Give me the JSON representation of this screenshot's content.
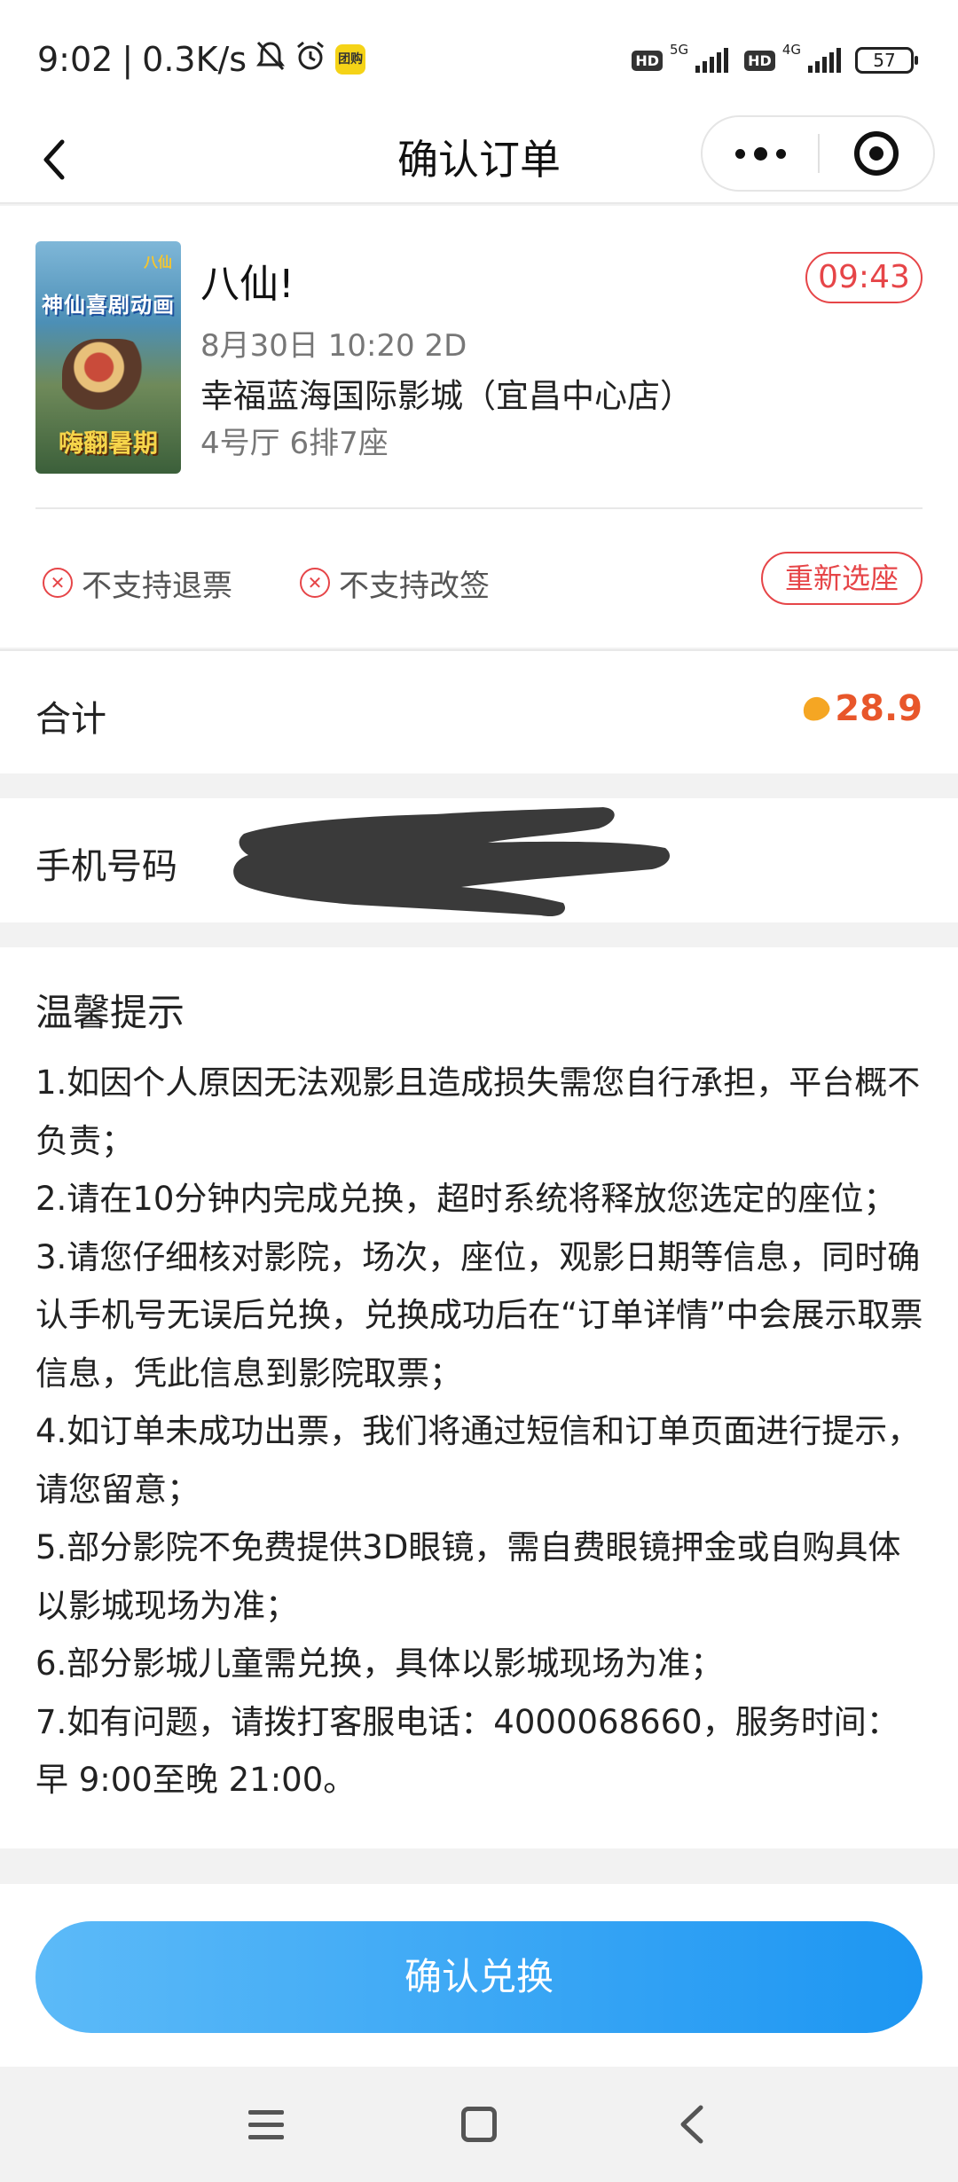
{
  "status_bar": {
    "time": "9:02",
    "speed": "0.3K/s",
    "hd1": "HD",
    "net1": "5G",
    "hd2": "HD",
    "net2": "4G",
    "battery": "57",
    "app_badge": "团购"
  },
  "nav": {
    "title": "确认订单",
    "back_icon": "chevron-left-icon",
    "more_icon": "more-dots-icon",
    "close_icon": "target-close-icon"
  },
  "order": {
    "poster_top_text": "神仙喜剧动画",
    "poster_logo_text": "八仙",
    "poster_bottom_text": "嗨翻暑期",
    "movie_title": "八仙!",
    "countdown": "09:43",
    "show_info": "8月30日  10:20  2D",
    "cinema": "幸福蓝海国际影城（宜昌中心店）",
    "seat_info": "4号厅  6排7座",
    "policies": [
      "不支持退票",
      "不支持改签"
    ],
    "reselect_label": "重新选座"
  },
  "total": {
    "label": "合计",
    "value": "28.9",
    "currency_icon": "coin-icon"
  },
  "phone": {
    "label": "手机号码"
  },
  "tips": {
    "title": "温馨提示",
    "items": [
      "1.如因个人原因无法观影且造成损失需您自行承担，平台概不负责；",
      "2.请在10分钟内完成兑换，超时系统将释放您选定的座位；",
      "3.请您仔细核对影院，场次，座位，观影日期等信息，同时确认手机号无误后兑换，兑换成功后在“订单详情”中会展示取票信息，凭此信息到影院取票；",
      "4.如订单未成功出票，我们将通过短信和订单页面进行提示，请您留意；",
      "5.部分影院不免费提供3D眼镜，需自费眼镜押金或自购具体以影城现场为准；",
      "6.部分影城儿童需兑换，具体以影城现场为准；",
      "7.如有问题，请拨打客服电话：4000068660，服务时间：早 9:00至晚 21:00。"
    ]
  },
  "confirm_label": "确认兑换",
  "colors": {
    "accent_red": "#e64548",
    "price_orange": "#e8562a",
    "button_blue_start": "#5cbaf8",
    "button_blue_end": "#1d96f2"
  }
}
